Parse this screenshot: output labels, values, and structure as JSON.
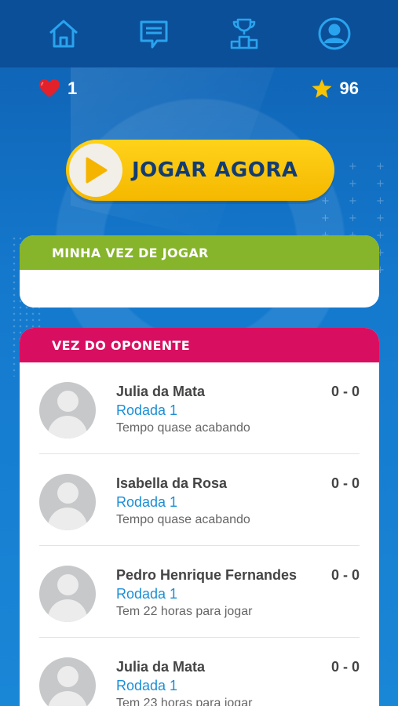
{
  "nav": {
    "items": [
      {
        "name": "home-icon"
      },
      {
        "name": "chat-icon"
      },
      {
        "name": "podium-icon"
      },
      {
        "name": "profile-icon"
      }
    ]
  },
  "stats": {
    "lives_icon": "heart-icon",
    "lives": "1",
    "stars_icon": "star-icon",
    "stars": "96"
  },
  "play": {
    "label": "JOGAR AGORA",
    "icon": "play-icon"
  },
  "my_turn": {
    "title": "MINHA VEZ DE JOGAR"
  },
  "opponent_turn": {
    "title": "VEZ DO OPONENTE",
    "games": [
      {
        "name": "Julia da Mata",
        "round": "Rodada 1",
        "status": "Tempo quase acabando",
        "score": "0 - 0"
      },
      {
        "name": "Isabella da Rosa",
        "round": "Rodada 1",
        "status": "Tempo quase acabando",
        "score": "0 - 0"
      },
      {
        "name": "Pedro Henrique Fernandes",
        "round": "Rodada 1",
        "status": "Tem 22 horas para jogar",
        "score": "0 - 0"
      },
      {
        "name": "Julia da Mata",
        "round": "Rodada 1",
        "status": "Tem 23 horas para jogar",
        "score": "0 - 0"
      }
    ]
  },
  "colors": {
    "nav_bg": "#0b4f98",
    "icon_blue": "#2aa3ee",
    "play_yellow": "#f8c300",
    "play_text": "#123c72",
    "my_turn_green": "#86b42b",
    "opponent_pink": "#d80f60",
    "round_blue": "#1b8fd6"
  }
}
